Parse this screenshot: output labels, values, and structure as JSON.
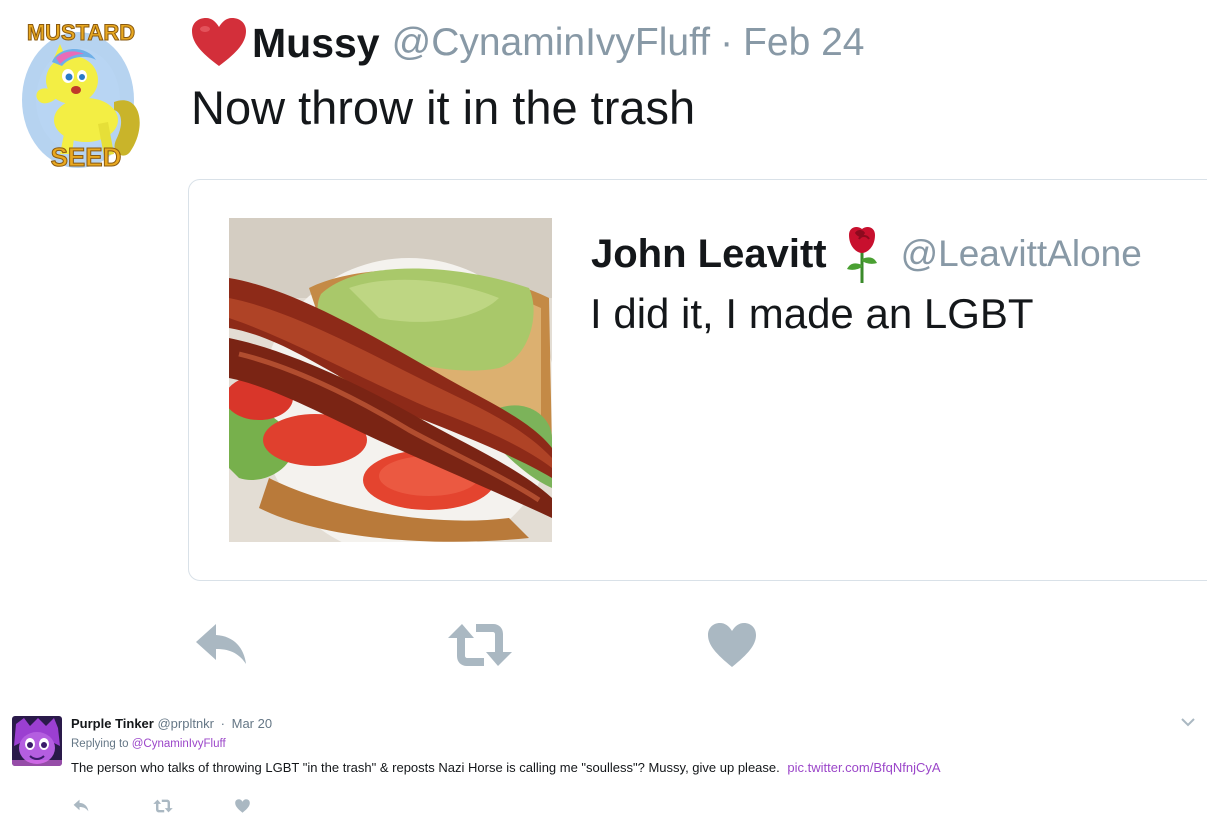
{
  "main_tweet": {
    "avatar_text_top": "MUSTARD",
    "avatar_text_bottom": "SEED",
    "heart_emoji": "heart-emoji",
    "name": "Mussy",
    "handle": "@CynaminIvyFluff",
    "separator": "·",
    "date": "Feb 24",
    "text": "Now throw it in the trash"
  },
  "quoted_tweet": {
    "photo": "blt-sandwich-photo",
    "name": "John Leavitt",
    "emoji": "rose-emoji",
    "handle": "@LeavittAlone",
    "text": "I did it, I made an LGBT"
  },
  "actions": {
    "reply_icon": "reply-icon",
    "retweet_icon": "retweet-icon",
    "like_icon": "heart-icon"
  },
  "reply_tweet": {
    "name": "Purple Tinker",
    "handle": "@prpltnkr",
    "separator": "·",
    "date": "Mar 20",
    "replying_prefix": "Replying to",
    "replying_to": "@CynaminIvyFluff",
    "text": "The person who talks of throwing LGBT \"in the trash\" & reposts Nazi Horse is calling me \"soulless\"? Mussy, give up please.",
    "pic_link": "pic.twitter.com/BfqNfnjCyA"
  },
  "colors": {
    "text": "#14171a",
    "muted": "#8899a6",
    "action_icon": "#aab8c2",
    "link": "#9b46c9",
    "card_border": "#d9e1e8"
  }
}
